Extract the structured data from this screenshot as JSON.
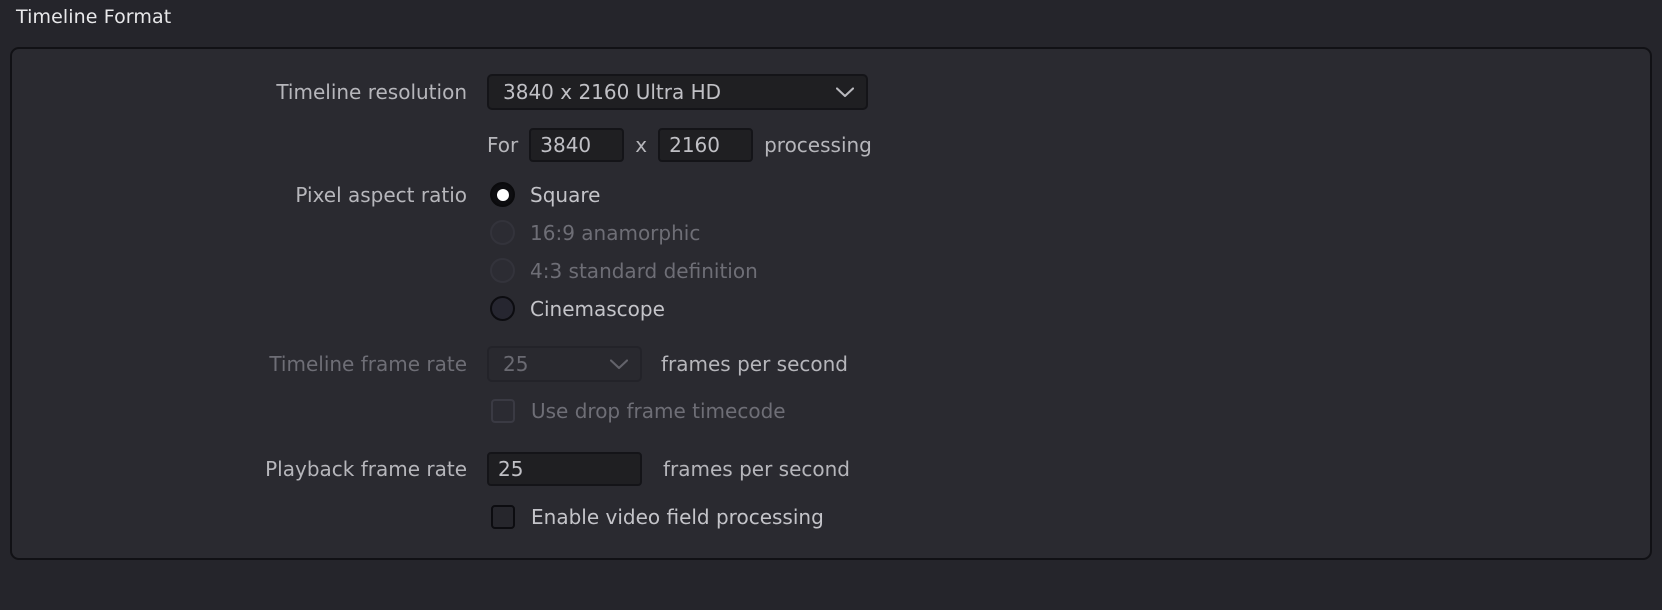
{
  "section": {
    "title": "Timeline Format"
  },
  "fields": {
    "timeline_resolution": {
      "label": "Timeline resolution",
      "value": "3840 x 2160 Ultra HD",
      "chevron_icon": "chevron-down-icon"
    },
    "processing": {
      "prefix": "For",
      "width": "3840",
      "separator": "x",
      "height": "2160",
      "suffix": "processing"
    },
    "pixel_aspect_ratio": {
      "label": "Pixel aspect ratio",
      "options": [
        {
          "label": "Square",
          "selected": true,
          "disabled": false
        },
        {
          "label": "16:9 anamorphic",
          "selected": false,
          "disabled": true
        },
        {
          "label": "4:3 standard definition",
          "selected": false,
          "disabled": true
        },
        {
          "label": "Cinemascope",
          "selected": false,
          "disabled": false
        }
      ]
    },
    "timeline_frame_rate": {
      "label": "Timeline frame rate",
      "value": "25",
      "unit": "frames per second",
      "disabled": true,
      "chevron_icon": "chevron-down-icon"
    },
    "use_drop_frame_timecode": {
      "label": "Use drop frame timecode",
      "checked": false,
      "disabled": true
    },
    "playback_frame_rate": {
      "label": "Playback frame rate",
      "value": "25",
      "unit": "frames per second"
    },
    "enable_video_field_processing": {
      "label": "Enable video field processing",
      "checked": false,
      "disabled": false
    }
  },
  "colors": {
    "background": "#25252b",
    "panel": "#2a2a30",
    "panel_border": "#111115",
    "title_text": "#e8e8ea",
    "label_text": "#b6b6bb",
    "disabled_text": "#6e6e76",
    "input_bg": "#1f1f22",
    "input_border": "#141418",
    "radio_dot": "#ffffff"
  }
}
